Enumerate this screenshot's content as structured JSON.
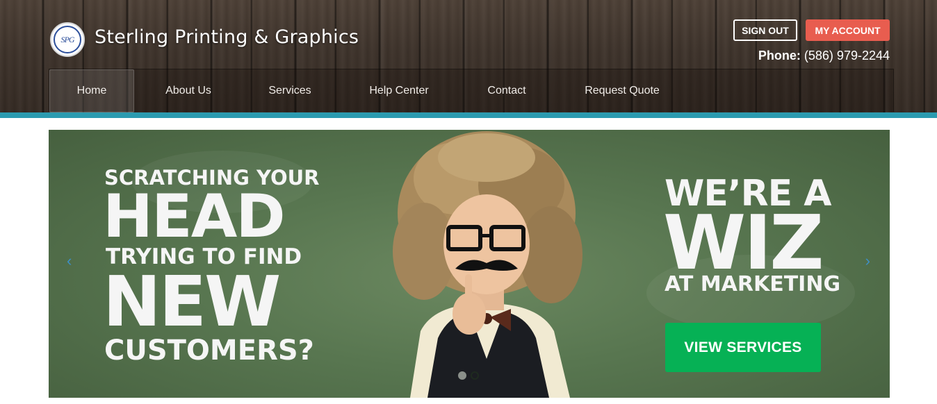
{
  "header": {
    "brand_name": "Sterling Printing & Graphics",
    "logo_text": "SPG",
    "sign_out_label": "SIGN OUT",
    "my_account_label": "MY ACCOUNT",
    "phone_label": "Phone:",
    "phone_number": "(586) 979-2244"
  },
  "nav": {
    "items": [
      {
        "label": "Home",
        "active": true
      },
      {
        "label": "About Us"
      },
      {
        "label": "Services"
      },
      {
        "label": "Help Center"
      },
      {
        "label": "Contact"
      },
      {
        "label": "Request Quote"
      }
    ]
  },
  "hero": {
    "left_lines": [
      "SCRATCHING YOUR",
      "HEAD",
      "TRYING TO FIND",
      "NEW",
      "CUSTOMERS?"
    ],
    "right_lines": [
      "WE’RE A",
      "WIZ",
      "AT MARKETING"
    ],
    "cta_label": "VIEW SERVICES",
    "prev_icon": "chevron-left-icon",
    "next_icon": "chevron-right-icon",
    "prev_glyph": "‹",
    "next_glyph": "›",
    "slide_count": 2,
    "active_slide": 1
  },
  "colors": {
    "accent_teal": "#2b9bb0",
    "account_button": "#e85d4f",
    "cta_green": "#06b155",
    "chalkboard": "#587650"
  }
}
